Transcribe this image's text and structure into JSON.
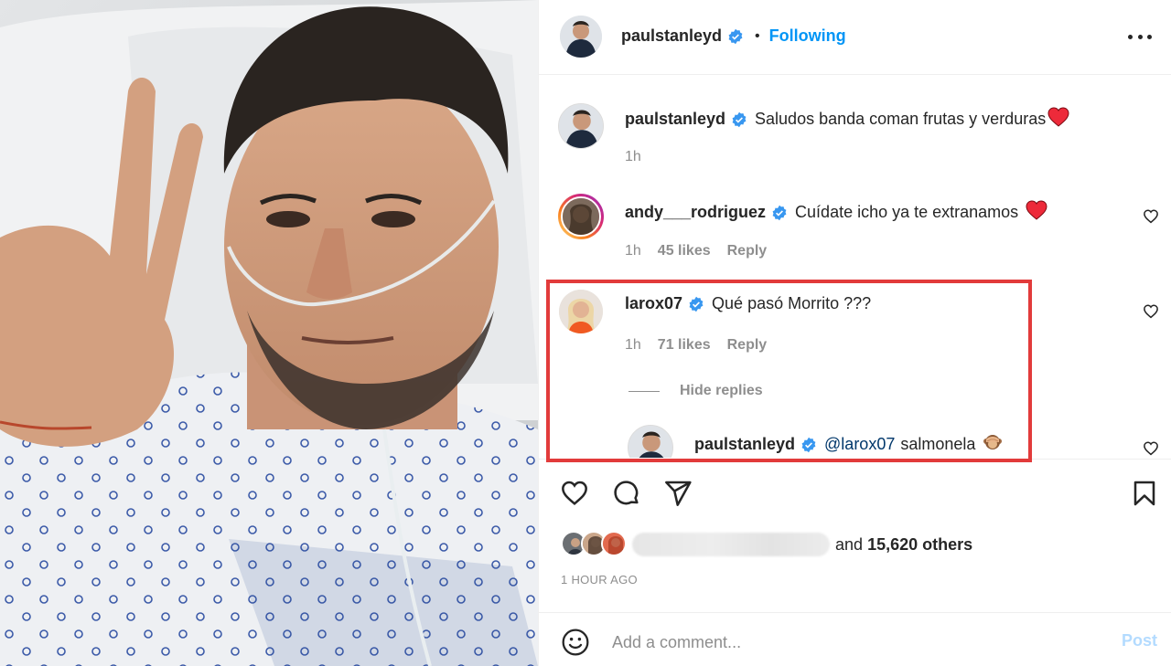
{
  "post": {
    "author": "paulstanleyd",
    "follow_state": "Following",
    "dot": "•",
    "caption_user": "paulstanleyd",
    "caption": "Saludos banda coman frutas y verduras",
    "caption_emoji": "heart",
    "caption_time": "1h"
  },
  "comments": [
    {
      "user": "andy___rodriguez",
      "text": "Cuídate icho ya te extranamos",
      "emoji": "heart",
      "time": "1h",
      "likes": "45 likes",
      "reply": "Reply"
    },
    {
      "user": "larox07",
      "text": "Qué pasó Morrito ???",
      "time": "1h",
      "likes": "71 likes",
      "reply": "Reply",
      "hide_replies": "Hide replies",
      "replies": [
        {
          "user": "paulstanleyd",
          "mention": "@larox07",
          "text": "salmonela",
          "emoji": "see-no-evil-monkey"
        }
      ]
    }
  ],
  "engagement": {
    "liked_and": "and",
    "others": "15,620 others",
    "time_ago": "1 HOUR AGO"
  },
  "composer": {
    "placeholder": "Add a comment...",
    "post_label": "Post"
  },
  "colors": {
    "link_blue": "#0095f6",
    "verified_blue": "#3897f0",
    "highlight_red": "#e23b3b",
    "heart_red": "#ed2a3a",
    "post_disabled": "#b3dbff"
  },
  "icons": [
    "more-options-icon",
    "verified-badge-icon",
    "like-icon",
    "comment-icon",
    "share-icon",
    "save-icon",
    "emoji-icon",
    "heart-emoji-icon",
    "see-no-evil-monkey-emoji-icon"
  ]
}
